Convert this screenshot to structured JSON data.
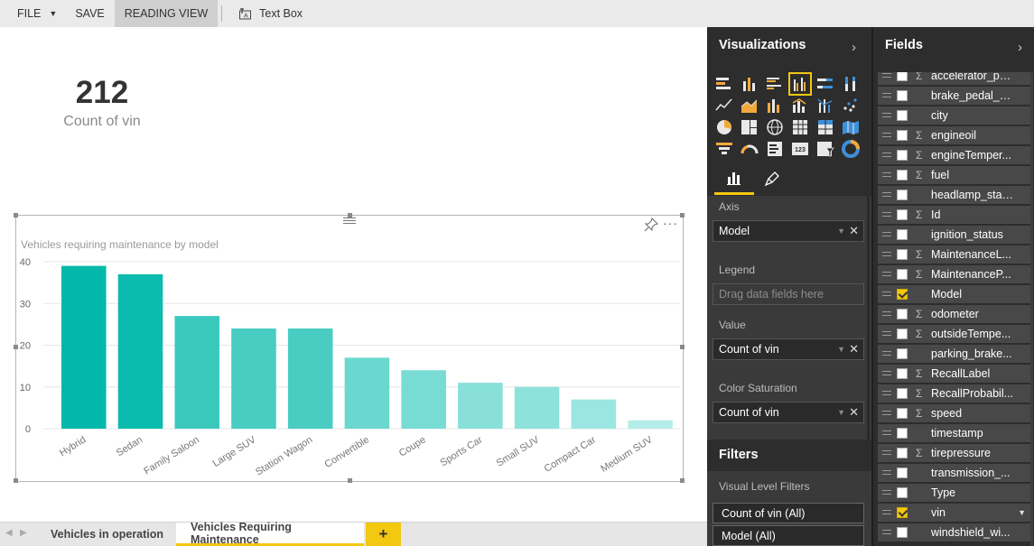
{
  "menubar": {
    "file_label": "FILE",
    "save_label": "SAVE",
    "reading_view_label": "READING VIEW",
    "textbox_label": "Text Box"
  },
  "card": {
    "value": "212",
    "label": "Count of vin"
  },
  "chart_data": {
    "type": "bar",
    "title": "Vehicles requiring maintenance by model",
    "categories": [
      "Hybrid",
      "Sedan",
      "Family Saloon",
      "Large SUV",
      "Station Wagon",
      "Convertible",
      "Coupe",
      "Sports Car",
      "Small SUV",
      "Compact Car",
      "Medium SUV"
    ],
    "values": [
      39,
      37,
      27,
      24,
      24,
      17,
      14,
      11,
      10,
      7,
      2
    ],
    "ylim": [
      0,
      40
    ],
    "yticks": [
      0,
      10,
      20,
      30,
      40
    ],
    "xlabel": "",
    "ylabel": "",
    "grid": true,
    "color_max": "#01b8aa",
    "color_min": "#b3ede8"
  },
  "page_tabs": [
    {
      "label": "Vehicles in operation",
      "active": false
    },
    {
      "label": "Vehicles Requiring Maintenance",
      "active": true
    }
  ],
  "add_page_label": "+",
  "visualizations": {
    "header": "Visualizations",
    "axis_label": "Axis",
    "axis_value": "Model",
    "legend_label": "Legend",
    "legend_placeholder": "Drag data fields here",
    "value_label": "Value",
    "value_value": "Count of vin",
    "color_saturation_label": "Color Saturation",
    "color_saturation_value": "Count of vin",
    "icons": [
      "stacked-bar-icon",
      "stacked-column-icon",
      "clustered-bar-icon",
      "clustered-column-icon",
      "100-bar-icon",
      "100-column-icon",
      "line-chart-icon",
      "area-chart-icon",
      "stacked-area-icon",
      "line-column-icon",
      "line-clustered-column-icon",
      "scatter-chart-icon",
      "pie-chart-icon",
      "treemap-icon",
      "map-icon",
      "table-icon",
      "matrix-icon",
      "filled-map-icon",
      "funnel-icon",
      "gauge-icon",
      "multi-row-card-icon",
      "card-icon",
      "slicer-icon",
      "donut-chart-icon"
    ]
  },
  "filters": {
    "header": "Filters",
    "sub_label": "Visual Level Filters",
    "items": [
      "Count of vin (All)",
      "Model (All)"
    ]
  },
  "fields": {
    "header": "Fields",
    "items": [
      {
        "name": "accelerator_pe...",
        "sigma": true,
        "checked": false
      },
      {
        "name": "brake_pedal_s...",
        "sigma": false,
        "checked": false
      },
      {
        "name": "city",
        "sigma": false,
        "checked": false
      },
      {
        "name": "engineoil",
        "sigma": true,
        "checked": false
      },
      {
        "name": "engineTemper...",
        "sigma": true,
        "checked": false
      },
      {
        "name": "fuel",
        "sigma": true,
        "checked": false
      },
      {
        "name": "headlamp_stat...",
        "sigma": false,
        "checked": false
      },
      {
        "name": "Id",
        "sigma": true,
        "checked": false
      },
      {
        "name": "ignition_status",
        "sigma": false,
        "checked": false
      },
      {
        "name": "MaintenanceL...",
        "sigma": true,
        "checked": false
      },
      {
        "name": "MaintenanceP...",
        "sigma": true,
        "checked": false
      },
      {
        "name": "Model",
        "sigma": false,
        "checked": true
      },
      {
        "name": "odometer",
        "sigma": true,
        "checked": false
      },
      {
        "name": "outsideTempe...",
        "sigma": true,
        "checked": false
      },
      {
        "name": "parking_brake...",
        "sigma": false,
        "checked": false
      },
      {
        "name": "RecallLabel",
        "sigma": true,
        "checked": false
      },
      {
        "name": "RecallProbabil...",
        "sigma": true,
        "checked": false
      },
      {
        "name": "speed",
        "sigma": true,
        "checked": false
      },
      {
        "name": "timestamp",
        "sigma": false,
        "checked": false
      },
      {
        "name": "tirepressure",
        "sigma": true,
        "checked": false
      },
      {
        "name": "transmission_...",
        "sigma": false,
        "checked": false
      },
      {
        "name": "Type",
        "sigma": false,
        "checked": false
      },
      {
        "name": "vin",
        "sigma": false,
        "checked": true,
        "dropdown": true
      },
      {
        "name": "windshield_wi...",
        "sigma": false,
        "checked": false
      }
    ]
  }
}
